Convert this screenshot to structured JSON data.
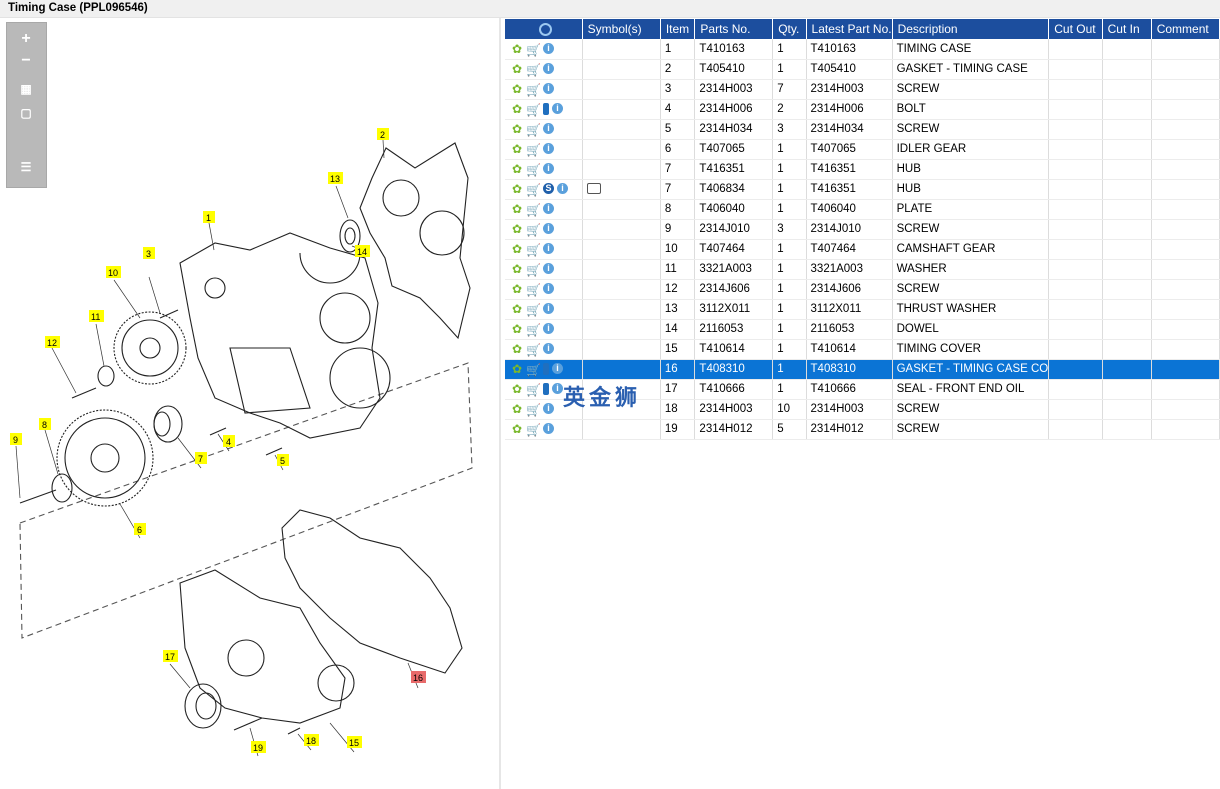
{
  "window": {
    "title": "Timing Case (PPL096546)"
  },
  "toolbar": {
    "buttons": [
      "zoom-in-icon",
      "zoom-out-icon",
      "fit-grid-icon",
      "actual-size-icon",
      "toggle-list-icon"
    ]
  },
  "diagram": {
    "callouts": [
      "1",
      "2",
      "3",
      "4",
      "5",
      "6",
      "7",
      "8",
      "9",
      "10",
      "11",
      "12",
      "13",
      "14",
      "15",
      "16",
      "17",
      "18",
      "19"
    ],
    "selected_callout": "16",
    "highlight_color": "#ffff00",
    "selected_color": "#e86a6a"
  },
  "table": {
    "headers": [
      "Symbol(s)",
      "Item",
      "Parts No.",
      "Qty.",
      "Latest Part No.",
      "Description",
      "Cut Out",
      "Cut In",
      "Comment"
    ],
    "header_color": "#1c4e9e",
    "selected_color": "#0b74d5",
    "rows": [
      {
        "item": "1",
        "part": "T410163",
        "qty": "1",
        "latest": "T410163",
        "desc": "TIMING CASE"
      },
      {
        "item": "2",
        "part": "T405410",
        "qty": "1",
        "latest": "T405410",
        "desc": "GASKET - TIMING CASE"
      },
      {
        "item": "3",
        "part": "2314H003",
        "qty": "7",
        "latest": "2314H003",
        "desc": "SCREW"
      },
      {
        "item": "4",
        "part": "2314H006",
        "qty": "2",
        "latest": "2314H006",
        "desc": "BOLT"
      },
      {
        "item": "5",
        "part": "2314H034",
        "qty": "3",
        "latest": "2314H034",
        "desc": "SCREW"
      },
      {
        "item": "6",
        "part": "T407065",
        "qty": "1",
        "latest": "T407065",
        "desc": "IDLER GEAR"
      },
      {
        "item": "7",
        "part": "T416351",
        "qty": "1",
        "latest": "T416351",
        "desc": "HUB"
      },
      {
        "item": "7",
        "part": "T406834",
        "qty": "1",
        "latest": "T416351",
        "desc": "HUB"
      },
      {
        "item": "8",
        "part": "T406040",
        "qty": "1",
        "latest": "T406040",
        "desc": "PLATE"
      },
      {
        "item": "9",
        "part": "2314J010",
        "qty": "3",
        "latest": "2314J010",
        "desc": "SCREW"
      },
      {
        "item": "10",
        "part": "T407464",
        "qty": "1",
        "latest": "T407464",
        "desc": "CAMSHAFT GEAR"
      },
      {
        "item": "11",
        "part": "3321A003",
        "qty": "1",
        "latest": "3321A003",
        "desc": "WASHER"
      },
      {
        "item": "12",
        "part": "2314J606",
        "qty": "1",
        "latest": "2314J606",
        "desc": "SCREW"
      },
      {
        "item": "13",
        "part": "3112X011",
        "qty": "1",
        "latest": "3112X011",
        "desc": "THRUST WASHER"
      },
      {
        "item": "14",
        "part": "2116053",
        "qty": "1",
        "latest": "2116053",
        "desc": "DOWEL"
      },
      {
        "item": "15",
        "part": "T410614",
        "qty": "1",
        "latest": "T410614",
        "desc": "TIMING COVER"
      },
      {
        "item": "16",
        "part": "T408310",
        "qty": "1",
        "latest": "T408310",
        "desc": "GASKET - TIMING CASE CO"
      },
      {
        "item": "17",
        "part": "T410666",
        "qty": "1",
        "latest": "T410666",
        "desc": "SEAL - FRONT END OIL"
      },
      {
        "item": "18",
        "part": "2314H003",
        "qty": "10",
        "latest": "2314H003",
        "desc": "SCREW"
      },
      {
        "item": "19",
        "part": "2314H012",
        "qty": "5",
        "latest": "2314H012",
        "desc": "SCREW"
      }
    ]
  },
  "watermark": "英金狮"
}
